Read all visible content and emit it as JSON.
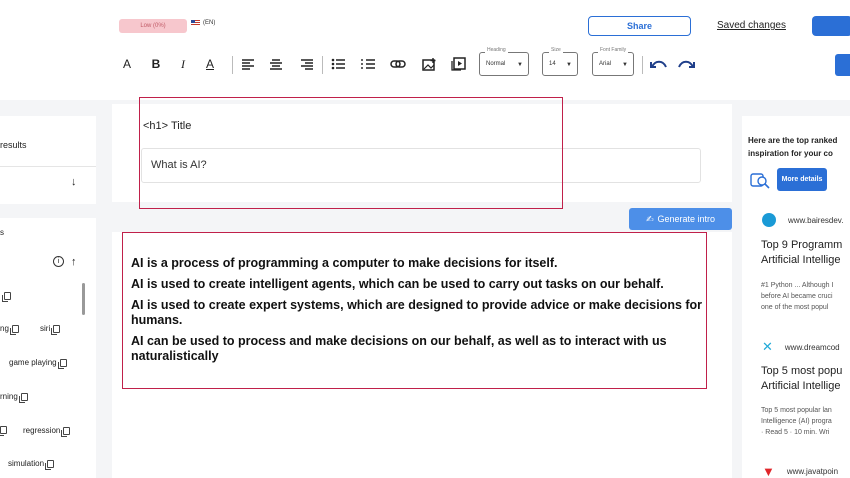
{
  "header": {
    "badge": "Low (0%)",
    "language": "(EN)",
    "share_label": "Share",
    "saved_label": "Saved changes"
  },
  "toolbar": {
    "heading_label": "Heading",
    "heading_value": "Normal",
    "size_label": "Size",
    "size_value": "14",
    "font_label": "Font Family",
    "font_value": "Arial"
  },
  "left_panel": {
    "results_label": "results",
    "chips": [
      "ng",
      "siri",
      "game playing",
      "rning",
      "regression",
      "simulation"
    ]
  },
  "editor": {
    "h1_label": "<h1> Title",
    "title_value": "What is AI?",
    "generate_label": "Generate intro",
    "paragraphs": [
      "AI is a process of programming a computer to make decisions for itself.",
      "AI is used to create intelligent agents, which can be used to carry out tasks on our behalf.",
      "AI is used to create expert systems, which are designed to provide advice or make decisions for humans.",
      "AI can be used to process and make decisions on our behalf, as well as to interact with us naturalistically"
    ]
  },
  "right_panel": {
    "header_line1": "Here are the top ranked",
    "header_line2": "inspiration for your co",
    "more_label": "More details",
    "results": [
      {
        "source": "www.bairesdev.",
        "title1": "Top 9 Programm",
        "title2": "Artificial Intellige",
        "desc1": "#1 Python ... Although I",
        "desc2": "before AI became cruci",
        "desc3": "one of the most popul",
        "color": "#1a9ad6"
      },
      {
        "source": "www.dreamcod",
        "title1": "Top 5 most popu",
        "title2": "Artificial Intellige",
        "desc1": "Top 5 most popular lan",
        "desc2": "Intelligence (AI) progra",
        "desc3": "· Read 5 · 10 min. Wri",
        "color": "#22aad8"
      },
      {
        "source": "www.javatpoin",
        "title1": "",
        "title2": "",
        "desc1": "",
        "desc2": "",
        "desc3": "",
        "color": "#e0262a"
      }
    ]
  },
  "colors": {
    "accent": "#2b6fd6",
    "highlight_border": "#c0204a"
  }
}
